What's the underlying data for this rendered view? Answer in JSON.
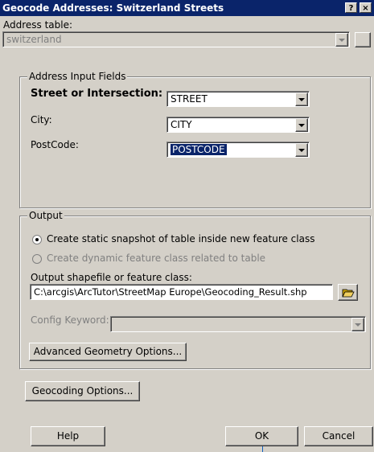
{
  "dialog": {
    "title": "Geocode Addresses:  Switzerland Streets",
    "help_btn": "?",
    "close_btn": "×"
  },
  "address_table": {
    "label": "Address table:",
    "value": "switzerland"
  },
  "input_fields": {
    "group_title": "Address Input Fields",
    "street_label": "Street or Intersection:",
    "street_value": "STREET",
    "city_label": "City:",
    "city_value": "CITY",
    "postcode_label": "PostCode:",
    "postcode_value": "POSTCODE"
  },
  "output": {
    "group_title": "Output",
    "radio_static": "Create static snapshot of table inside new feature class",
    "radio_dynamic": "Create dynamic feature class related to table",
    "shapefile_label": "Output shapefile or feature class:",
    "shapefile_value": "C:\\arcgis\\ArcTutor\\StreetMap Europe\\Geocoding_Result.shp",
    "config_label": "Config Keyword:",
    "advanced_btn": "Advanced Geometry Options..."
  },
  "buttons": {
    "geocoding_options": "Geocoding Options...",
    "help": "Help",
    "ok": "OK",
    "cancel": "Cancel"
  }
}
